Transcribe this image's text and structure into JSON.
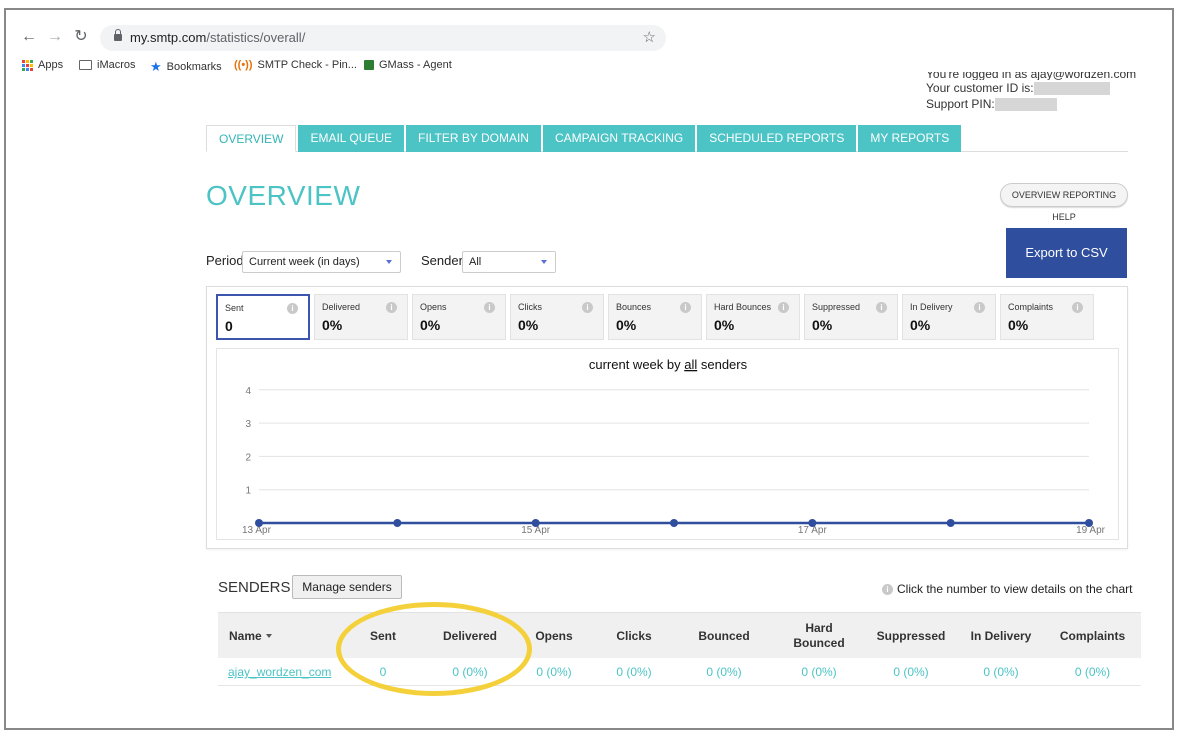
{
  "browser": {
    "url_domain": "my.smtp.com",
    "url_path": "/statistics/overall/",
    "bookmarks": [
      "Apps",
      "iMacros",
      "Bookmarks",
      "SMTP Check - Pin...",
      "GMass - Agent"
    ]
  },
  "account": {
    "logged_in": "You're logged in as ajay@wordzen.com",
    "customer_id_label": "Your customer ID is:",
    "pin_label": "Support PIN:"
  },
  "tabs": [
    "OVERVIEW",
    "EMAIL QUEUE",
    "FILTER BY DOMAIN",
    "CAMPAIGN TRACKING",
    "SCHEDULED REPORTS",
    "MY REPORTS"
  ],
  "page": {
    "title": "OVERVIEW",
    "help_button": "OVERVIEW REPORTING HELP",
    "export_button": "Export to CSV"
  },
  "filters": {
    "period_label": "Period",
    "period_value": "Current week (in days)",
    "sender_label": "Sender",
    "sender_value": "All"
  },
  "metrics": [
    {
      "label": "Sent",
      "value": "0"
    },
    {
      "label": "Delivered",
      "value": "0%"
    },
    {
      "label": "Opens",
      "value": "0%"
    },
    {
      "label": "Clicks",
      "value": "0%"
    },
    {
      "label": "Bounces",
      "value": "0%"
    },
    {
      "label": "Hard Bounces",
      "value": "0%"
    },
    {
      "label": "Suppressed",
      "value": "0%"
    },
    {
      "label": "In Delivery",
      "value": "0%"
    },
    {
      "label": "Complaints",
      "value": "0%"
    }
  ],
  "chart_data": {
    "type": "line",
    "title_prefix": "current week by ",
    "title_emph": "all",
    "title_suffix": " senders",
    "x": [
      "13 Apr",
      "14 Apr",
      "15 Apr",
      "16 Apr",
      "17 Apr",
      "18 Apr",
      "19 Apr"
    ],
    "x_tick_labels": [
      "13 Apr",
      "15 Apr",
      "17 Apr",
      "19 Apr"
    ],
    "y_ticks": [
      1,
      2,
      3,
      4
    ],
    "ylim": [
      0,
      4
    ],
    "series": [
      {
        "values": [
          0,
          0,
          0,
          0,
          0,
          0,
          0
        ]
      }
    ],
    "line_color": "#2f4e9e",
    "grid": true
  },
  "senders": {
    "title": "SENDERS",
    "manage_button": "Manage senders",
    "hint": "Click the number to view details on the chart",
    "columns": [
      "Name",
      "Sent",
      "Delivered",
      "Opens",
      "Clicks",
      "Bounced",
      "Hard Bounced",
      "Suppressed",
      "In Delivery",
      "Complaints"
    ],
    "rows": [
      [
        "ajay_wordzen_com",
        "0",
        "0 (0%)",
        "0 (0%)",
        "0 (0%)",
        "0 (0%)",
        "0 (0%)",
        "0 (0%)",
        "0 (0%)",
        "0 (0%)"
      ]
    ]
  },
  "colors": {
    "accent": "#4cc3c5",
    "primary": "#2f4e9e",
    "highlight": "#f4d03a"
  }
}
